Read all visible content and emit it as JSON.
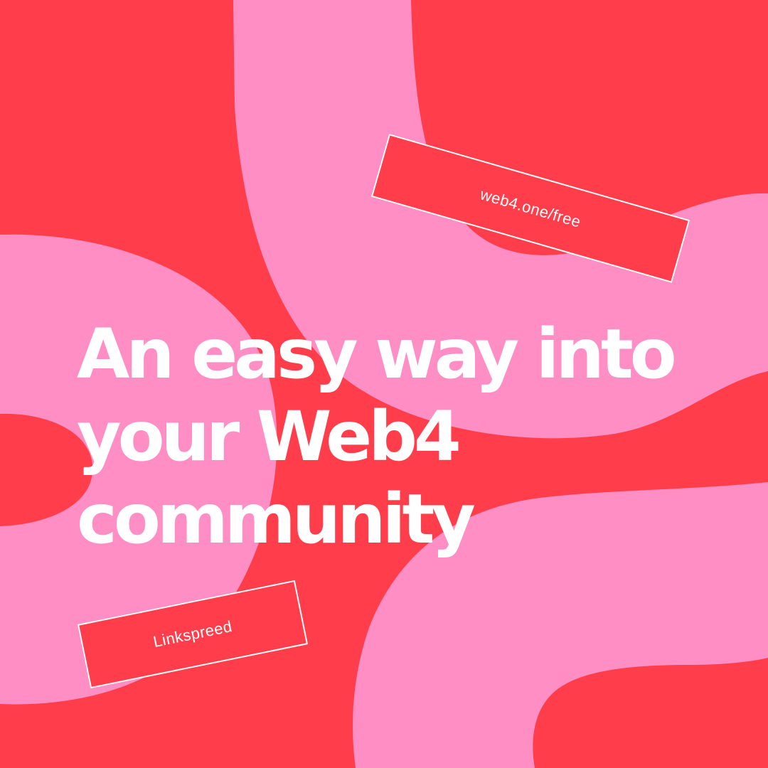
{
  "headline": {
    "line1": "An easy way into",
    "line2": "your Web4",
    "line3": "community"
  },
  "tags": {
    "url": "web4.one/free",
    "brand": "Linkspreed"
  },
  "colors": {
    "background_red": "#ff3d4b",
    "accent_pink": "#ff8ec4",
    "text_white": "#ffffff"
  }
}
